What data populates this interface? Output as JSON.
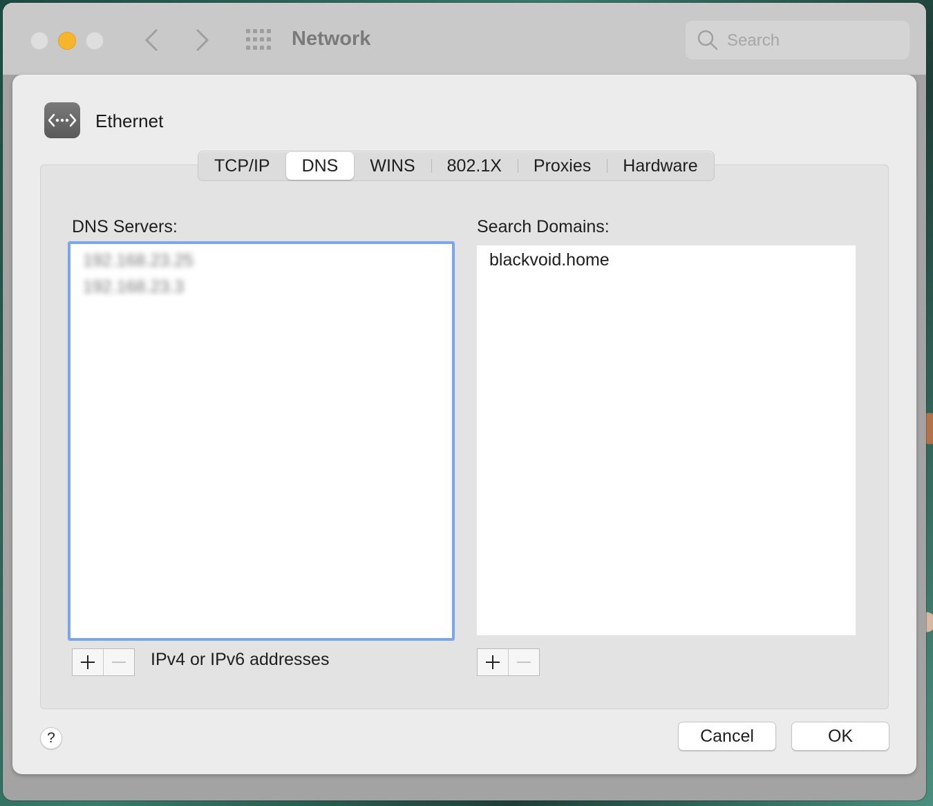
{
  "window": {
    "title": "Network"
  },
  "toolbar": {
    "search_placeholder": "Search"
  },
  "service": {
    "name": "Ethernet"
  },
  "tabs": [
    {
      "label": "TCP/IP",
      "active": false
    },
    {
      "label": "DNS",
      "active": true
    },
    {
      "label": "WINS",
      "active": false
    },
    {
      "label": "802.1X",
      "active": false
    },
    {
      "label": "Proxies",
      "active": false
    },
    {
      "label": "Hardware",
      "active": false
    }
  ],
  "dns": {
    "label": "DNS Servers:",
    "servers": [
      "192.168.23.25",
      "192.168.23.3"
    ],
    "hint": "IPv4 or IPv6 addresses"
  },
  "domains": {
    "label": "Search Domains:",
    "items": [
      "blackvoid.home"
    ]
  },
  "buttons": {
    "help": "?",
    "cancel": "Cancel",
    "ok": "OK"
  },
  "colors": {
    "accent_focus": "#7aa7ec",
    "minimize_light": "#f6b62b"
  },
  "icons": [
    "close-light",
    "minimize-light",
    "zoom-light",
    "back-arrow-icon",
    "forward-arrow-icon",
    "grid-icon",
    "search-icon",
    "ethernet-icon",
    "plus-icon",
    "minus-icon",
    "help-icon"
  ]
}
